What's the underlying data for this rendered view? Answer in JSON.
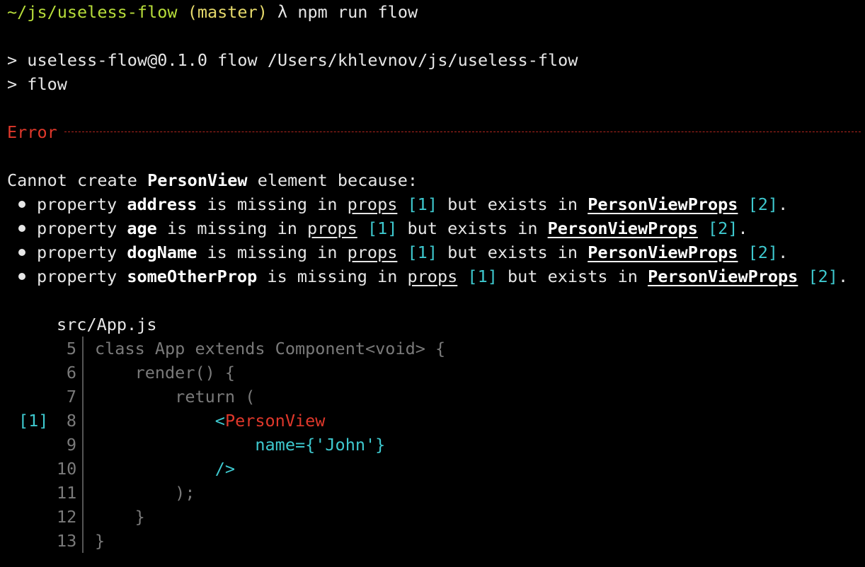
{
  "prompt": {
    "path": "~/js/useless-flow",
    "branch": "(master)",
    "lambda": "λ",
    "command": "npm run flow"
  },
  "npm_output": {
    "line1": "> useless-flow@0.1.0 flow /Users/khlevnov/js/useless-flow",
    "line2": "> flow"
  },
  "error": {
    "label": "Error",
    "summary_prefix": "Cannot create ",
    "summary_component": "PersonView",
    "summary_suffix": " element because:",
    "items": [
      {
        "prefix": "property ",
        "prop": "address",
        "mid": " is missing in ",
        "props_link": "props",
        "ref1": "[1]",
        "mid2": " but exists in ",
        "type_link": "PersonViewProps",
        "ref2": "[2]",
        "end": "."
      },
      {
        "prefix": "property ",
        "prop": "age",
        "mid": " is missing in ",
        "props_link": "props",
        "ref1": "[1]",
        "mid2": " but exists in ",
        "type_link": "PersonViewProps",
        "ref2": "[2]",
        "end": "."
      },
      {
        "prefix": "property ",
        "prop": "dogName",
        "mid": " is missing in ",
        "props_link": "props",
        "ref1": "[1]",
        "mid2": " but exists in ",
        "type_link": "PersonViewProps",
        "ref2": "[2]",
        "end": "."
      },
      {
        "prefix": "property ",
        "prop": "someOtherProp",
        "mid": " is missing in ",
        "props_link": "props",
        "ref1": "[1]",
        "mid2": " but exists in ",
        "type_link": "PersonViewProps",
        "ref2": "[2]",
        "end": "."
      }
    ]
  },
  "code": {
    "file": "src/App.js",
    "ref_marker": "[1]",
    "lines": [
      {
        "num": "5",
        "text": "class App extends Component<void> {"
      },
      {
        "num": "6",
        "text": "    render() {"
      },
      {
        "num": "7",
        "text": "        return ("
      },
      {
        "num": "8",
        "indent": "            ",
        "tag_open": "<",
        "tag_name": "PersonView"
      },
      {
        "num": "9",
        "indent": "                ",
        "attr": "name={'John'}"
      },
      {
        "num": "10",
        "indent": "            ",
        "close": "/>"
      },
      {
        "num": "11",
        "text": "        );"
      },
      {
        "num": "12",
        "text": "    }"
      },
      {
        "num": "13",
        "text": "}"
      }
    ]
  },
  "colors": {
    "background": "#000000",
    "prompt_path": "#b7dd3a",
    "branch": "#e5d96b",
    "error": "#e0382b",
    "reference": "#3ec9cf",
    "dim_code": "#7a7a7a"
  }
}
